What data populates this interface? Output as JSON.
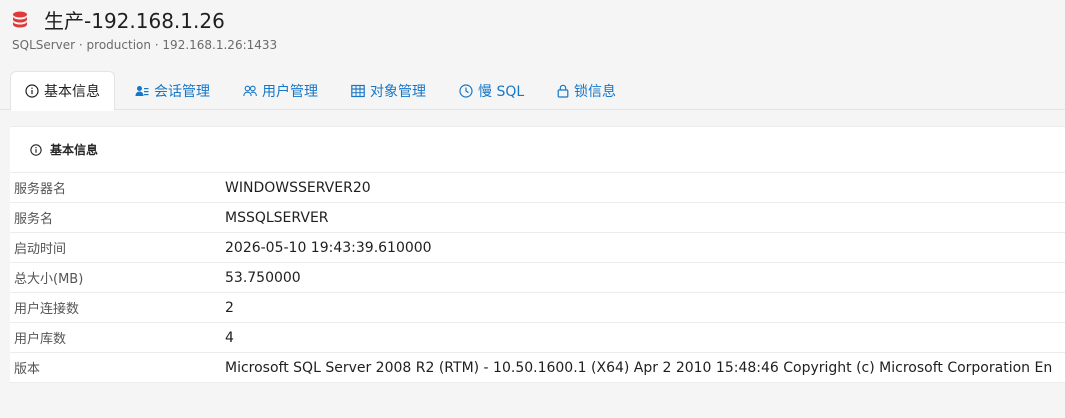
{
  "header": {
    "icon": "database-icon",
    "title": "生产-192.168.1.26",
    "subtitle": "SQLServer · production · 192.168.1.26:1433",
    "icon_color": "#e03a3a"
  },
  "tabs": [
    {
      "label": "基本信息",
      "icon": "info-icon",
      "active": true
    },
    {
      "label": "会话管理",
      "icon": "session-icon",
      "active": false
    },
    {
      "label": "用户管理",
      "icon": "users-icon",
      "active": false
    },
    {
      "label": "对象管理",
      "icon": "table-icon",
      "active": false
    },
    {
      "label": "慢 SQL",
      "icon": "clock-icon",
      "active": false
    },
    {
      "label": "锁信息",
      "icon": "lock-icon",
      "active": false
    }
  ],
  "card": {
    "title": "基本信息",
    "rows": [
      {
        "label": "服务器名",
        "value": "WINDOWSSERVER20"
      },
      {
        "label": "服务名",
        "value": "MSSQLSERVER"
      },
      {
        "label": "启动时间",
        "value": "2026-05-10 19:43:39.610000"
      },
      {
        "label": "总大小(MB)",
        "value": "53.750000"
      },
      {
        "label": "用户连接数",
        "value": "2"
      },
      {
        "label": "用户库数",
        "value": "4"
      },
      {
        "label": "版本",
        "value": "Microsoft SQL Server 2008 R2 (RTM) - 10.50.1600.1 (X64) Apr 2 2010 15:48:46 Copyright (c) Microsoft Corporation En"
      }
    ]
  },
  "colors": {
    "accent": "#1677c8",
    "background": "#f5f5f5"
  }
}
